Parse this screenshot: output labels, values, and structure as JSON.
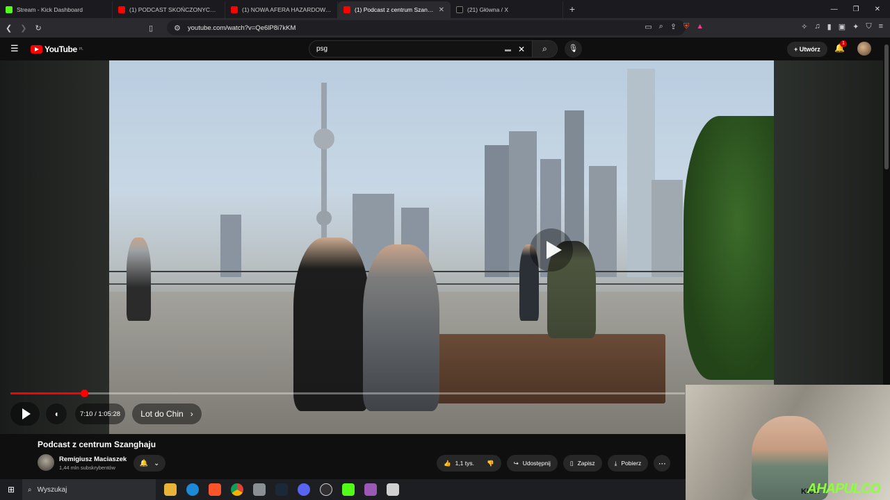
{
  "browser": {
    "tabs": [
      {
        "title": "Stream - Kick Dashboard",
        "color": "#53fc18"
      },
      {
        "title": "(1) PODCAST SKOŃCZONYCH STREA",
        "color": "#ff0000"
      },
      {
        "title": "(1) NOWA AFERA HAZARDOWA - RU",
        "color": "#ff0000"
      },
      {
        "title": "(1) Podcast z centrum Szanghaju",
        "color": "#ff0000"
      },
      {
        "title": "(21) Główna / X",
        "color": "#ffffff"
      }
    ],
    "url": "youtube.com/watch?v=Qe6lP8i7kKM"
  },
  "yt": {
    "logo_text": "YouTube",
    "logo_region": "PL",
    "search_value": "psg",
    "create_label": "Utwórz",
    "notif_count": "1"
  },
  "player": {
    "progress_fraction": 0.109,
    "time": "7:10 / 1:05:28",
    "chapter": "Lot do Chin"
  },
  "video_info": {
    "title": "Podcast z centrum Szanghaju",
    "channel": "Remigiusz Maciaszek",
    "subscribers": "1,44 mln subskrybentów",
    "likes": "1,1 tys.",
    "share": "Udostępnij",
    "save": "Zapisz",
    "download": "Pobierz"
  },
  "taskbar": {
    "search_placeholder": "Wyszukaj"
  },
  "overlay": {
    "logo": "AHAPULCO",
    "kick": "KICK"
  }
}
